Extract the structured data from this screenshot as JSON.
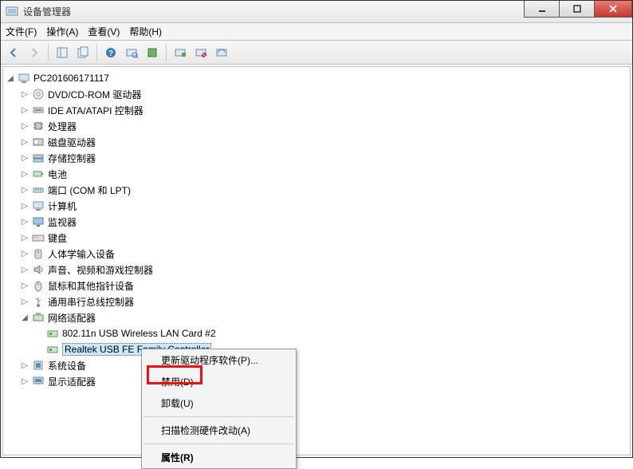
{
  "window": {
    "title": "设备管理器"
  },
  "menu": {
    "file": "文件(F)",
    "action": "操作(A)",
    "view": "查看(V)",
    "help": "帮助(H)"
  },
  "tree": {
    "root": "PC201606171117",
    "items": [
      "DVD/CD-ROM 驱动器",
      "IDE ATA/ATAPI 控制器",
      "处理器",
      "磁盘驱动器",
      "存储控制器",
      "电池",
      "端口 (COM 和 LPT)",
      "计算机",
      "监视器",
      "键盘",
      "人体学输入设备",
      "声音、视频和游戏控制器",
      "鼠标和其他指针设备",
      "通用串行总线控制器",
      "网络适配器",
      "系统设备",
      "显示适配器"
    ],
    "network_children": [
      "802.11n USB Wireless LAN Card #2",
      "Realtek USB FE Family Controller"
    ]
  },
  "context": {
    "update": "更新驱动程序软件(P)...",
    "disable": "禁用(D)",
    "uninstall": "卸载(U)",
    "scan": "扫描检测硬件改动(A)",
    "properties": "属性(R)"
  }
}
